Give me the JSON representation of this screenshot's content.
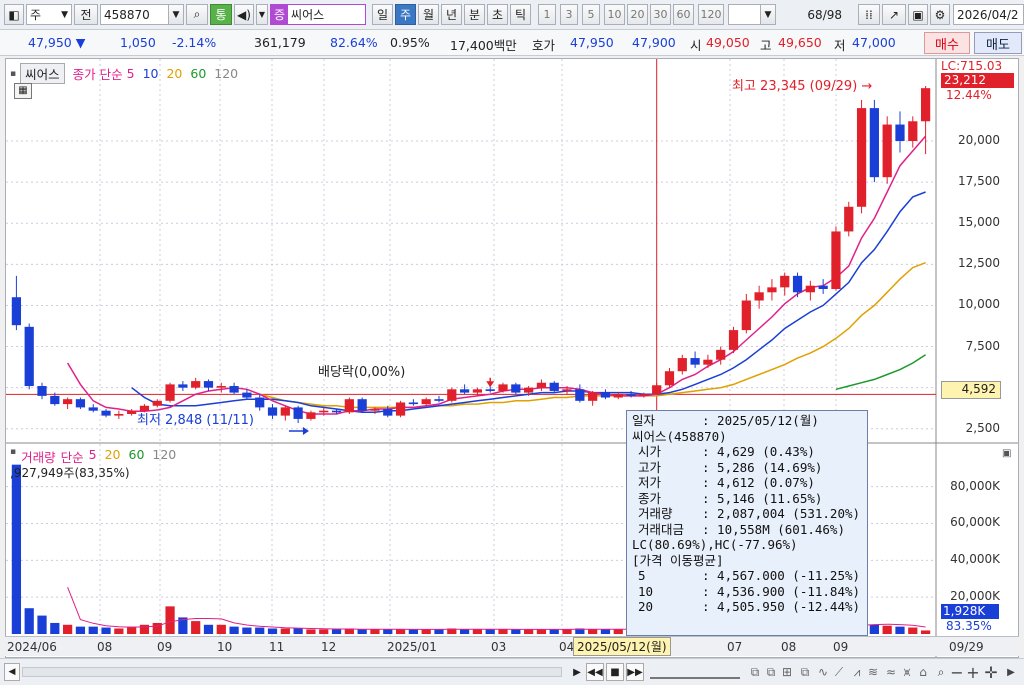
{
  "toolbar": {
    "type_label": "주",
    "jeon_label": "전",
    "code": "458870",
    "tong_label": "통",
    "jeung_label": "증",
    "name": "씨어스",
    "periods": [
      "일",
      "주",
      "월",
      "년",
      "분",
      "초",
      "틱"
    ],
    "active_period": "주",
    "intervals": [
      "1",
      "3",
      "5",
      "10",
      "20",
      "30",
      "60",
      "120"
    ],
    "count": "68",
    "count_total": "/98",
    "date": "2026/04/2"
  },
  "quote": {
    "price": "47,950",
    "change": "1,050",
    "change_pct": "-2.14%",
    "volume": "361,179",
    "ratio1": "82.64%",
    "ratio2": "0.95%",
    "amount": "17,400백만",
    "hoga_label": "호가",
    "ask": "47,950",
    "bid": "47,900",
    "open_label": "시",
    "open": "49,050",
    "high_label": "고",
    "high": "49,650",
    "low_label": "저",
    "low": "47,000",
    "buy_button": "매수",
    "sell_button": "매도"
  },
  "price_panel": {
    "name_button": "씨어스",
    "ma_label": "종가 단순",
    "ma_periods": [
      "5",
      "10",
      "20",
      "60",
      "120"
    ],
    "ma_colors": [
      "#e0208a",
      "#1a3fd6",
      "#e0a000",
      "#1a9a2a",
      "#888888"
    ],
    "high_annotation": "최고 23,345 (09/29) →",
    "low_annotation": "최저 2,848 (11/11)",
    "dividend_annotation": "배당락(0,00%)",
    "lc_label": "LC:715.03",
    "last_price": "23,212",
    "last_pct": "12.44%",
    "hline_value": "4,592",
    "y_ticks": [
      "20,000",
      "17,500",
      "15,000",
      "12,500",
      "10,000",
      "7,500",
      "5,000",
      "2,500"
    ]
  },
  "volume_panel": {
    "title": "거래량",
    "ma_label": "단순",
    "ma_periods": [
      "5",
      "20",
      "60",
      "120"
    ],
    "max_volume": ",927,949주(83,35%)",
    "last_volume": "1,928K",
    "last_pct": "83.35%",
    "y_ticks": [
      "80,000K",
      "60,000K",
      "40,000K",
      "20,000K"
    ]
  },
  "time_axis": {
    "labels": [
      "2024/06",
      "08",
      "09",
      "10",
      "11",
      "12",
      "2025/01",
      "03",
      "04",
      "07",
      "08",
      "09"
    ],
    "cursor_label": "2025/05/12(월)",
    "right_label": "09/29"
  },
  "tooltip": {
    "date_label": "일자",
    "date": ": 2025/05/12(월)",
    "stock": "씨어스(458870)",
    "rows": [
      {
        "k": "시가",
        "v": ": 4,629 (0.43%)"
      },
      {
        "k": "고가",
        "v": ": 5,286 (14.69%)"
      },
      {
        "k": "저가",
        "v": ": 4,612 (0.07%)"
      },
      {
        "k": "종가",
        "v": ": 5,146 (11.65%)"
      },
      {
        "k": "거래량",
        "v": ": 2,087,004 (531.20%)"
      },
      {
        "k": "거래대금",
        "v": ": 10,558M (601.46%)"
      }
    ],
    "lchc": "LC(80.69%),HC(-77.96%)",
    "ma_header": "[가격 이동평균]",
    "ma_rows": [
      {
        "k": "5",
        "v": ": 4,567.000 (-11.25%)"
      },
      {
        "k": "10",
        "v": ": 4,536.900 (-11.84%)"
      },
      {
        "k": "20",
        "v": ": 4,505.950 (-12.44%)"
      }
    ]
  },
  "chart_data": {
    "type": "candlestick",
    "ohlc": [
      [
        10500,
        11800,
        8500,
        8800
      ],
      [
        8700,
        8900,
        4900,
        5100
      ],
      [
        5100,
        5300,
        4300,
        4500
      ],
      [
        4500,
        4700,
        3900,
        4000
      ],
      [
        4000,
        4400,
        3700,
        4300
      ],
      [
        4300,
        4400,
        3700,
        3800
      ],
      [
        3800,
        4000,
        3500,
        3600
      ],
      [
        3600,
        3700,
        3200,
        3300
      ],
      [
        3300,
        3600,
        3100,
        3400
      ],
      [
        3400,
        3700,
        3300,
        3600
      ],
      [
        3600,
        4000,
        3500,
        3900
      ],
      [
        3900,
        4300,
        3800,
        4200
      ],
      [
        4200,
        5300,
        4100,
        5200
      ],
      [
        5200,
        5400,
        4800,
        5000
      ],
      [
        5000,
        5600,
        4900,
        5400
      ],
      [
        5400,
        5500,
        4800,
        5000
      ],
      [
        5000,
        5300,
        4700,
        5100
      ],
      [
        5100,
        5300,
        4600,
        4700
      ],
      [
        4700,
        4900,
        4300,
        4400
      ],
      [
        4400,
        4600,
        3600,
        3800
      ],
      [
        3800,
        4000,
        3100,
        3300
      ],
      [
        3300,
        3900,
        3000,
        3800
      ],
      [
        3800,
        3900,
        2848,
        3100
      ],
      [
        3100,
        3600,
        3000,
        3500
      ],
      [
        3500,
        3800,
        3300,
        3600
      ],
      [
        3600,
        3700,
        3400,
        3500
      ],
      [
        3500,
        4400,
        3400,
        4300
      ],
      [
        4300,
        4400,
        3500,
        3600
      ],
      [
        3600,
        3800,
        3400,
        3700
      ],
      [
        3700,
        3900,
        3200,
        3300
      ],
      [
        3300,
        4200,
        3200,
        4100
      ],
      [
        4100,
        4300,
        3900,
        4000
      ],
      [
        4000,
        4400,
        3900,
        4300
      ],
      [
        4300,
        4500,
        4100,
        4200
      ],
      [
        4200,
        5000,
        4100,
        4900
      ],
      [
        4900,
        5200,
        4600,
        4700
      ],
      [
        4700,
        5000,
        4500,
        4900
      ],
      [
        4900,
        5100,
        4700,
        4800
      ],
      [
        4800,
        5300,
        4700,
        5200
      ],
      [
        5200,
        5300,
        4600,
        4700
      ],
      [
        4700,
        5100,
        4500,
        5000
      ],
      [
        5000,
        5500,
        4800,
        5300
      ],
      [
        5300,
        5400,
        4700,
        4800
      ],
      [
        4800,
        5100,
        4600,
        4900
      ],
      [
        4900,
        5200,
        4100,
        4200
      ],
      [
        4200,
        4800,
        3900,
        4700
      ],
      [
        4700,
        4900,
        4300,
        4400
      ],
      [
        4400,
        4700,
        4300,
        4600
      ],
      [
        4600,
        4800,
        4400,
        4500
      ],
      [
        4500,
        4700,
        4400,
        4600
      ],
      [
        4629,
        5286,
        4612,
        5146
      ],
      [
        5146,
        6200,
        5000,
        6000
      ],
      [
        6000,
        7000,
        5800,
        6800
      ],
      [
        6800,
        7200,
        6200,
        6400
      ],
      [
        6400,
        7000,
        6200,
        6700
      ],
      [
        6700,
        7500,
        6400,
        7300
      ],
      [
        7300,
        8700,
        7100,
        8500
      ],
      [
        8500,
        10700,
        8300,
        10300
      ],
      [
        10300,
        11200,
        9800,
        10800
      ],
      [
        10800,
        11600,
        10300,
        11100
      ],
      [
        11100,
        12000,
        10600,
        11800
      ],
      [
        11800,
        12000,
        10500,
        10800
      ],
      [
        10800,
        11500,
        10300,
        11200
      ],
      [
        11200,
        11600,
        10700,
        11000
      ],
      [
        11000,
        14800,
        10900,
        14500
      ],
      [
        14500,
        16300,
        14200,
        16000
      ],
      [
        16000,
        22500,
        15600,
        22000
      ],
      [
        22000,
        22500,
        17500,
        17800
      ],
      [
        17800,
        21500,
        17400,
        21000
      ],
      [
        21000,
        21800,
        19300,
        20000
      ],
      [
        20000,
        21500,
        19600,
        21200
      ],
      [
        21200,
        23345,
        19200,
        23212
      ]
    ],
    "ma5": [
      null,
      null,
      null,
      null,
      6500,
      5200,
      4200,
      3800,
      3700,
      3560,
      3560,
      3640,
      3800,
      4200,
      4600,
      4800,
      4900,
      5000,
      4900,
      4600,
      4200,
      3900,
      3600,
      3400,
      3400,
      3400,
      3600,
      3600,
      3700,
      3700,
      3800,
      3800,
      3900,
      4000,
      4300,
      4400,
      4500,
      4600,
      4800,
      4900,
      4900,
      5000,
      5000,
      5000,
      4900,
      4700,
      4600,
      4500,
      4500,
      4500,
      4600,
      5000,
      5500,
      5800,
      6300,
      6700,
      7200,
      7900,
      8600,
      9300,
      10100,
      10700,
      11100,
      11200,
      11700,
      12400,
      14100,
      15300,
      16900,
      18500,
      19400,
      20300
    ],
    "ma10": [
      null,
      null,
      null,
      null,
      null,
      null,
      null,
      null,
      null,
      5000,
      4400,
      4000,
      3900,
      3900,
      3900,
      4000,
      4100,
      4200,
      4300,
      4300,
      4300,
      4200,
      4100,
      3900,
      3800,
      3700,
      3600,
      3500,
      3500,
      3600,
      3600,
      3700,
      3800,
      3900,
      4000,
      4100,
      4200,
      4300,
      4400,
      4500,
      4600,
      4700,
      4700,
      4800,
      4800,
      4700,
      4700,
      4700,
      4700,
      4600,
      4600,
      4700,
      4900,
      5200,
      5500,
      5800,
      6200,
      6700,
      7300,
      7900,
      8600,
      9100,
      9600,
      10000,
      10700,
      11400,
      12600,
      13400,
      14500,
      15700,
      16600,
      16900
    ],
    "ma20": [
      null,
      null,
      null,
      null,
      null,
      null,
      null,
      null,
      null,
      null,
      null,
      null,
      null,
      null,
      null,
      null,
      null,
      null,
      null,
      4600,
      4400,
      4200,
      4100,
      4000,
      3900,
      3900,
      3800,
      3800,
      3800,
      3800,
      3800,
      3800,
      3800,
      3900,
      3900,
      4000,
      4000,
      4100,
      4100,
      4200,
      4200,
      4300,
      4400,
      4400,
      4500,
      4500,
      4500,
      4500,
      4500,
      4500,
      4500,
      4600,
      4700,
      4800,
      4900,
      5000,
      5200,
      5500,
      5800,
      6100,
      6400,
      6800,
      7100,
      7500,
      8000,
      8600,
      9400,
      10000,
      10800,
      11600,
      12300,
      12600
    ],
    "ma60": [
      null,
      null,
      null,
      null,
      null,
      null,
      null,
      null,
      null,
      null,
      null,
      null,
      null,
      null,
      null,
      null,
      null,
      null,
      null,
      null,
      null,
      null,
      null,
      null,
      null,
      null,
      null,
      null,
      null,
      null,
      null,
      null,
      null,
      null,
      null,
      null,
      null,
      null,
      null,
      null,
      null,
      null,
      null,
      null,
      null,
      null,
      null,
      null,
      null,
      null,
      null,
      null,
      null,
      null,
      null,
      null,
      null,
      null,
      null,
      null,
      null,
      null,
      null,
      null,
      4900,
      5100,
      5300,
      5500,
      5800,
      6100,
      6500,
      7000
    ],
    "volume": [
      91927,
      14000,
      10000,
      6000,
      5000,
      4000,
      4000,
      3500,
      3000,
      4000,
      5000,
      6000,
      15000,
      9000,
      7000,
      5000,
      5000,
      4000,
      3500,
      3500,
      3000,
      3000,
      3000,
      2500,
      2500,
      2500,
      3000,
      2500,
      2500,
      2500,
      2500,
      2500,
      2500,
      2500,
      3000,
      2500,
      2500,
      2500,
      2500,
      2500,
      2500,
      2500,
      2500,
      2500,
      3000,
      2500,
      2500,
      2500,
      2500,
      2500,
      2087,
      3000,
      3500,
      3000,
      3000,
      3500,
      4000,
      5000,
      4500,
      4000,
      4500,
      4000,
      3500,
      3500,
      5000,
      5000,
      7000,
      5000,
      4500,
      4000,
      3500,
      1928
    ],
    "y_range": [
      2000,
      24500
    ],
    "vol_range": [
      0,
      95000
    ]
  }
}
